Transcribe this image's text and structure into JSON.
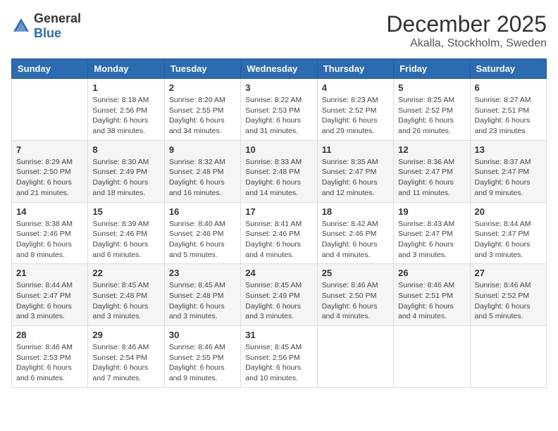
{
  "logo": {
    "general": "General",
    "blue": "Blue"
  },
  "header": {
    "month": "December 2025",
    "location": "Akalla, Stockholm, Sweden"
  },
  "weekdays": [
    "Sunday",
    "Monday",
    "Tuesday",
    "Wednesday",
    "Thursday",
    "Friday",
    "Saturday"
  ],
  "weeks": [
    [
      {
        "day": "",
        "info": ""
      },
      {
        "day": "1",
        "info": "Sunrise: 8:18 AM\nSunset: 2:56 PM\nDaylight: 6 hours\nand 38 minutes."
      },
      {
        "day": "2",
        "info": "Sunrise: 8:20 AM\nSunset: 2:55 PM\nDaylight: 6 hours\nand 34 minutes."
      },
      {
        "day": "3",
        "info": "Sunrise: 8:22 AM\nSunset: 2:53 PM\nDaylight: 6 hours\nand 31 minutes."
      },
      {
        "day": "4",
        "info": "Sunrise: 8:23 AM\nSunset: 2:52 PM\nDaylight: 6 hours\nand 29 minutes."
      },
      {
        "day": "5",
        "info": "Sunrise: 8:25 AM\nSunset: 2:52 PM\nDaylight: 6 hours\nand 26 minutes."
      },
      {
        "day": "6",
        "info": "Sunrise: 8:27 AM\nSunset: 2:51 PM\nDaylight: 6 hours\nand 23 minutes."
      }
    ],
    [
      {
        "day": "7",
        "info": "Sunrise: 8:29 AM\nSunset: 2:50 PM\nDaylight: 6 hours\nand 21 minutes."
      },
      {
        "day": "8",
        "info": "Sunrise: 8:30 AM\nSunset: 2:49 PM\nDaylight: 6 hours\nand 18 minutes."
      },
      {
        "day": "9",
        "info": "Sunrise: 8:32 AM\nSunset: 2:48 PM\nDaylight: 6 hours\nand 16 minutes."
      },
      {
        "day": "10",
        "info": "Sunrise: 8:33 AM\nSunset: 2:48 PM\nDaylight: 6 hours\nand 14 minutes."
      },
      {
        "day": "11",
        "info": "Sunrise: 8:35 AM\nSunset: 2:47 PM\nDaylight: 6 hours\nand 12 minutes."
      },
      {
        "day": "12",
        "info": "Sunrise: 8:36 AM\nSunset: 2:47 PM\nDaylight: 6 hours\nand 11 minutes."
      },
      {
        "day": "13",
        "info": "Sunrise: 8:37 AM\nSunset: 2:47 PM\nDaylight: 6 hours\nand 9 minutes."
      }
    ],
    [
      {
        "day": "14",
        "info": "Sunrise: 8:38 AM\nSunset: 2:46 PM\nDaylight: 6 hours\nand 8 minutes."
      },
      {
        "day": "15",
        "info": "Sunrise: 8:39 AM\nSunset: 2:46 PM\nDaylight: 6 hours\nand 6 minutes."
      },
      {
        "day": "16",
        "info": "Sunrise: 8:40 AM\nSunset: 2:46 PM\nDaylight: 6 hours\nand 5 minutes."
      },
      {
        "day": "17",
        "info": "Sunrise: 8:41 AM\nSunset: 2:46 PM\nDaylight: 6 hours\nand 4 minutes."
      },
      {
        "day": "18",
        "info": "Sunrise: 8:42 AM\nSunset: 2:46 PM\nDaylight: 6 hours\nand 4 minutes."
      },
      {
        "day": "19",
        "info": "Sunrise: 8:43 AM\nSunset: 2:47 PM\nDaylight: 6 hours\nand 3 minutes."
      },
      {
        "day": "20",
        "info": "Sunrise: 8:44 AM\nSunset: 2:47 PM\nDaylight: 6 hours\nand 3 minutes."
      }
    ],
    [
      {
        "day": "21",
        "info": "Sunrise: 8:44 AM\nSunset: 2:47 PM\nDaylight: 6 hours\nand 3 minutes."
      },
      {
        "day": "22",
        "info": "Sunrise: 8:45 AM\nSunset: 2:48 PM\nDaylight: 6 hours\nand 3 minutes."
      },
      {
        "day": "23",
        "info": "Sunrise: 8:45 AM\nSunset: 2:48 PM\nDaylight: 6 hours\nand 3 minutes."
      },
      {
        "day": "24",
        "info": "Sunrise: 8:45 AM\nSunset: 2:49 PM\nDaylight: 6 hours\nand 3 minutes."
      },
      {
        "day": "25",
        "info": "Sunrise: 8:46 AM\nSunset: 2:50 PM\nDaylight: 6 hours\nand 4 minutes."
      },
      {
        "day": "26",
        "info": "Sunrise: 8:46 AM\nSunset: 2:51 PM\nDaylight: 6 hours\nand 4 minutes."
      },
      {
        "day": "27",
        "info": "Sunrise: 8:46 AM\nSunset: 2:52 PM\nDaylight: 6 hours\nand 5 minutes."
      }
    ],
    [
      {
        "day": "28",
        "info": "Sunrise: 8:46 AM\nSunset: 2:53 PM\nDaylight: 6 hours\nand 6 minutes."
      },
      {
        "day": "29",
        "info": "Sunrise: 8:46 AM\nSunset: 2:54 PM\nDaylight: 6 hours\nand 7 minutes."
      },
      {
        "day": "30",
        "info": "Sunrise: 8:46 AM\nSunset: 2:55 PM\nDaylight: 6 hours\nand 9 minutes."
      },
      {
        "day": "31",
        "info": "Sunrise: 8:45 AM\nSunset: 2:56 PM\nDaylight: 6 hours\nand 10 minutes."
      },
      {
        "day": "",
        "info": ""
      },
      {
        "day": "",
        "info": ""
      },
      {
        "day": "",
        "info": ""
      }
    ]
  ]
}
